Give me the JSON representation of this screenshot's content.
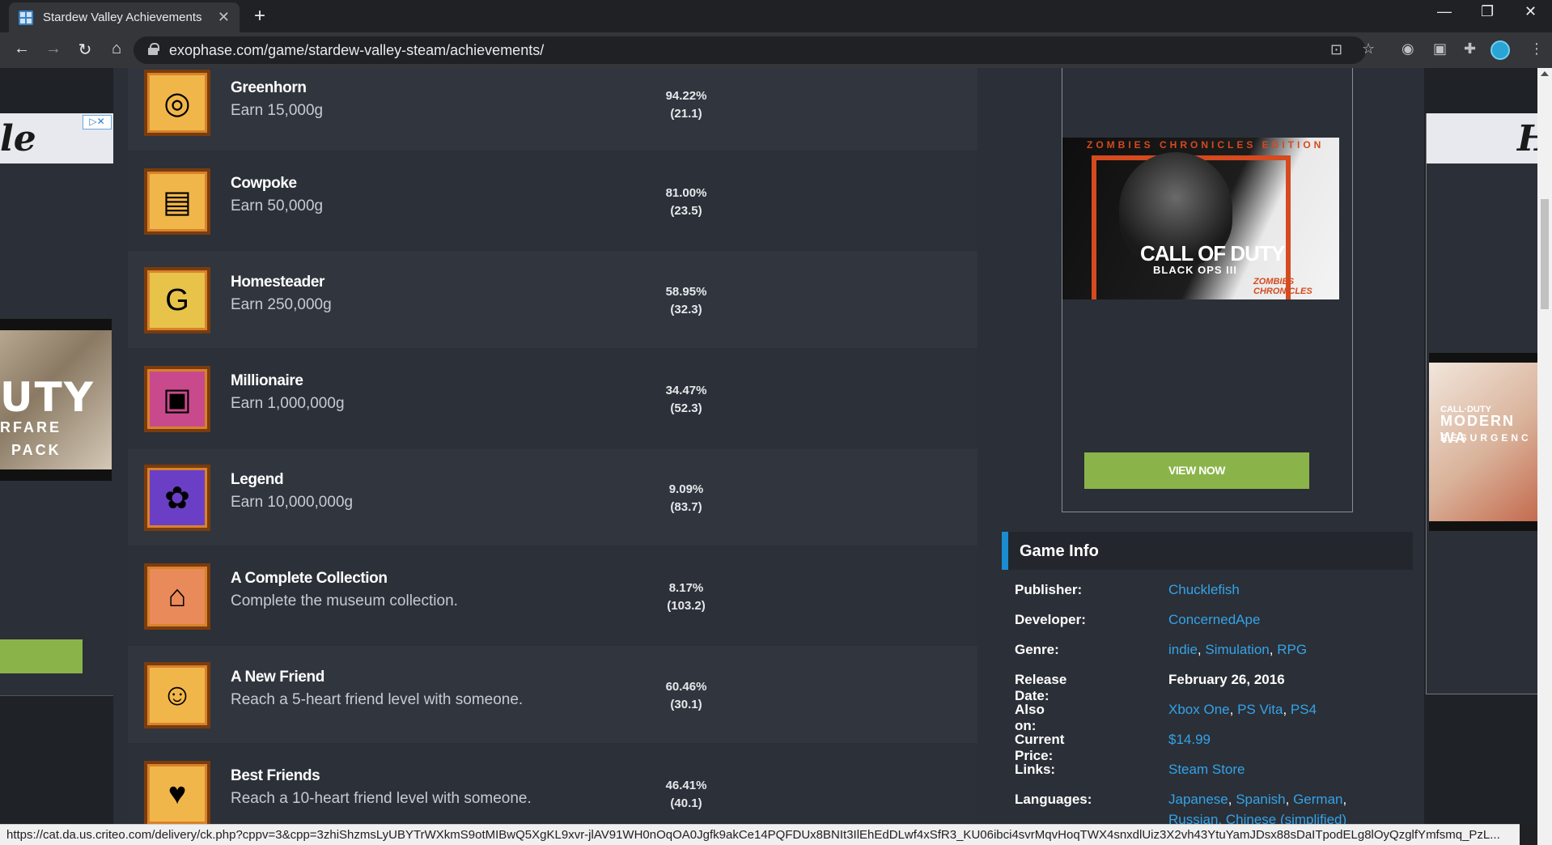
{
  "browser": {
    "tab_title": "Stardew Valley Achievements",
    "url": "exophase.com/game/stardew-valley-steam/achievements/",
    "status_url": "https://cat.da.us.criteo.com/delivery/ck.php?cppv=3&cpp=3zhiShzmsLyUBYTrWXkmS9otMIBwQ5XgKL9xvr-jlAV91WH0nOqOA0Jgfk9akCe14PQFDUx8BNIt3IlEhEdDLwf4xSfR3_KU06ibci4svrMqvHoqTWX4snxdlUiz3X2vh43YtuYamJDsx88sDaITpodELg8lOyQzglfYmfsmq_PzL..."
  },
  "achievements": [
    {
      "name": "Greenhorn",
      "desc": "Earn 15,000g",
      "pct": "94.22%",
      "pts": "(21.1)",
      "icon": "gold-coins-icon",
      "glyph": "◎",
      "bg": "#f1b64a"
    },
    {
      "name": "Cowpoke",
      "desc": "Earn 50,000g",
      "pct": "81.00%",
      "pts": "(23.5)",
      "icon": "coin-stack-icon",
      "glyph": "▤",
      "bg": "#f1b64a"
    },
    {
      "name": "Homesteader",
      "desc": "Earn 250,000g",
      "pct": "58.95%",
      "pts": "(32.3)",
      "icon": "money-bag-icon",
      "glyph": "G",
      "bg": "#e8c34a"
    },
    {
      "name": "Millionaire",
      "desc": "Earn 1,000,000g",
      "pct": "34.47%",
      "pts": "(52.3)",
      "icon": "treasure-chest-icon",
      "glyph": "▣",
      "bg": "#c94a8c"
    },
    {
      "name": "Legend",
      "desc": "Earn 10,000,000g",
      "pct": "9.09%",
      "pts": "(83.7)",
      "icon": "golden-cat-icon",
      "glyph": "✿",
      "bg": "#6a3fc6"
    },
    {
      "name": "A Complete Collection",
      "desc": "Complete the museum collection.",
      "pct": "8.17%",
      "pts": "(103.2)",
      "icon": "museum-icon",
      "glyph": "⌂",
      "bg": "#e98a5a"
    },
    {
      "name": "A New Friend",
      "desc": "Reach a 5-heart friend level with someone.",
      "pct": "60.46%",
      "pts": "(30.1)",
      "icon": "smiley-icon",
      "glyph": "☺",
      "bg": "#f1b64a"
    },
    {
      "name": "Best Friends",
      "desc": "Reach a 10-heart friend level with someone.",
      "pct": "46.41%",
      "pts": "(40.1)",
      "icon": "heart-icon",
      "glyph": "♥",
      "bg": "#f1b64a"
    }
  ],
  "ad_center": {
    "edition": "ZOMBIES CHRONICLES EDITION",
    "title": "CALL OF DUTY",
    "subtitle": "BLACK OPS III",
    "tag": "ZOMBIES CHRONICLES",
    "button": "VIEW NOW"
  },
  "ad_left": {
    "word": "le",
    "line1": "UTY",
    "line2": "RFARE",
    "line3": "PACK"
  },
  "ad_right": {
    "word": "H",
    "line1": "CALL·DUTY",
    "line2": "MODERN WA",
    "line3": "RESURGENC"
  },
  "game_info": {
    "header": "Game Info",
    "publisher_label": "Publisher:",
    "publisher": "Chucklefish",
    "developer_label": "Developer:",
    "developer": "ConcernedApe",
    "genre_label": "Genre:",
    "genres": [
      "indie",
      "Simulation",
      "RPG"
    ],
    "release_label": "Release Date:",
    "release": "February 26, 2016",
    "also_on_label": "Also on:",
    "also_on": [
      "Xbox One",
      "PS Vita",
      "PS4"
    ],
    "price_label": "Current Price:",
    "price": "$14.99",
    "links_label": "Links:",
    "links": "Steam Store",
    "languages_label": "Languages:",
    "languages": [
      "Japanese",
      "Spanish",
      "German"
    ],
    "languages_partial": "Russian, Chinese (simplified)"
  },
  "colors": {
    "link": "#34a3e8",
    "accent_bar": "#1b8cd1",
    "ad_button": "#8ab44a"
  }
}
